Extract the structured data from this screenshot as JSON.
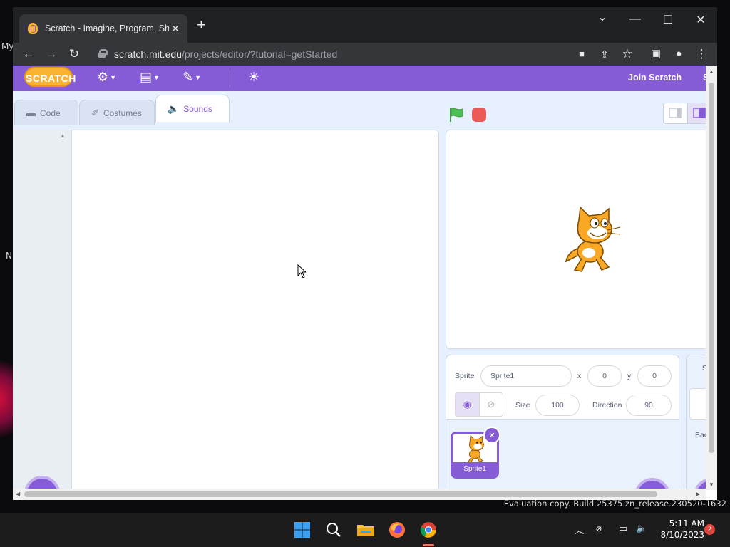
{
  "desktop": {
    "fragments": [
      "My",
      "N"
    ],
    "watermark": "Evaluation copy. Build 25375.zn_release.230520-1632"
  },
  "browser": {
    "tab_title": "Scratch - Imagine, Program, Shar",
    "tab_close": "✕",
    "new_tab": "+",
    "url_host": "scratch.mit.edu",
    "url_path": "/projects/editor/?tutorial=getStarted",
    "controls": {
      "minimize": "—",
      "maximize": "☐",
      "close": "✕",
      "tab_list": "⌄"
    }
  },
  "scratch_menu": {
    "logo": "SCRATCH",
    "join": "Join Scratch",
    "sign_in_fragment": "S"
  },
  "editor_tabs": [
    {
      "label": "Code",
      "icon": "code-icon"
    },
    {
      "label": "Costumes",
      "icon": "brush-icon"
    },
    {
      "label": "Sounds",
      "icon": "speaker-icon"
    }
  ],
  "sprite_info": {
    "sprite_label": "Sprite",
    "sprite_name": "Sprite1",
    "x_label": "x",
    "x_value": "0",
    "y_label": "y",
    "y_value": "0",
    "size_label": "Size",
    "size_value": "100",
    "direction_label": "Direction",
    "direction_value": "90"
  },
  "sprites": [
    {
      "name": "Sprite1"
    }
  ],
  "backdrop_pane": {
    "label_fragment": "Bac",
    "header_fragment": "S"
  },
  "taskbar": {
    "time": "5:11 AM",
    "date": "8/10/2023",
    "notifications": "2"
  },
  "colors": {
    "scratch_purple": "#855cd6",
    "stop_red": "#ec5959",
    "flag_green": "#4cbf56"
  }
}
